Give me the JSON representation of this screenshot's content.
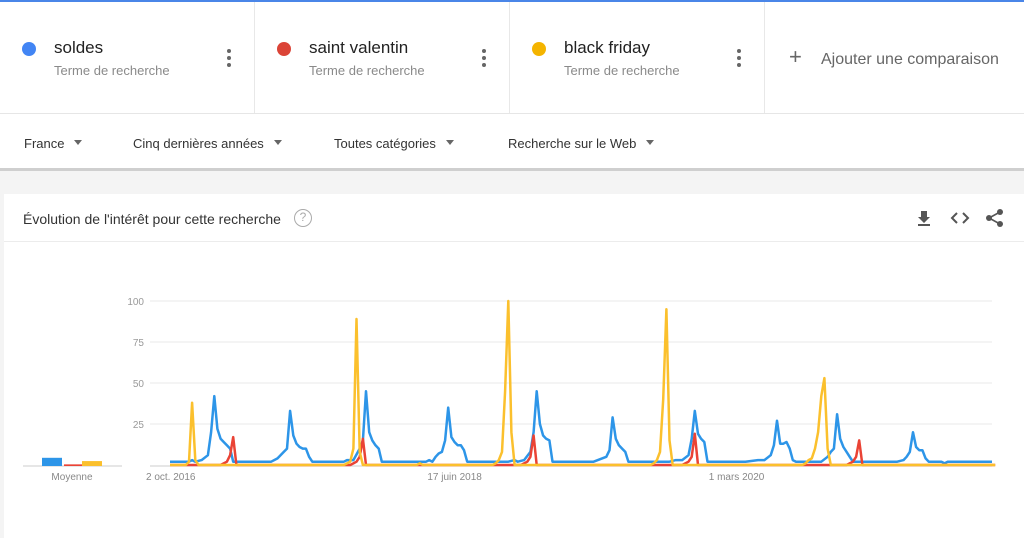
{
  "terms": [
    {
      "name": "soldes",
      "subtitle": "Terme de recherche",
      "color": "#4285f4"
    },
    {
      "name": "saint valentin",
      "subtitle": "Terme de recherche",
      "color": "#db4437"
    },
    {
      "name": "black friday",
      "subtitle": "Terme de recherche",
      "color": "#f4b400"
    }
  ],
  "add_comparison": {
    "icon": "plus-icon",
    "label": "Ajouter une comparaison"
  },
  "filters": [
    {
      "label": "France"
    },
    {
      "label": "Cinq dernières années"
    },
    {
      "label": "Toutes catégories"
    },
    {
      "label": "Recherche sur le Web"
    }
  ],
  "card": {
    "title": "Évolution de l'intérêt pour cette recherche",
    "help_icon": "?",
    "tools": [
      "download-icon",
      "embed-icon",
      "share-icon"
    ]
  },
  "chart_data": {
    "type": "line",
    "title": "Évolution de l'intérêt pour cette recherche",
    "xlabel": "",
    "ylabel": "",
    "ylim": [
      0,
      100
    ],
    "yticks": [
      "25",
      "50",
      "75",
      "100"
    ],
    "ytick_values": [
      25,
      50,
      75,
      100
    ],
    "grid": true,
    "legend": "top",
    "x_weeks": 261,
    "xticks": [
      {
        "label": "2 oct. 2016",
        "week": 0
      },
      {
        "label": "17 juin 2018",
        "week": 89
      },
      {
        "label": "1 mars 2020",
        "week": 178
      }
    ],
    "average": {
      "label": "Moyenne",
      "values": [
        {
          "name": "soldes",
          "value": 5
        },
        {
          "name": "saint valentin",
          "value": 1
        },
        {
          "name": "black friday",
          "value": 3
        }
      ]
    },
    "series": [
      {
        "name": "soldes",
        "color": "#2d95e8",
        "baseline": 2,
        "points": [
          [
            0,
            2
          ],
          [
            6,
            2
          ],
          [
            7,
            3
          ],
          [
            8,
            2
          ],
          [
            10,
            3
          ],
          [
            12,
            6
          ],
          [
            13,
            20
          ],
          [
            14,
            42
          ],
          [
            15,
            22
          ],
          [
            16,
            16
          ],
          [
            17,
            14
          ],
          [
            18,
            12
          ],
          [
            19,
            10
          ],
          [
            20,
            2
          ],
          [
            32,
            2
          ],
          [
            34,
            4
          ],
          [
            36,
            8
          ],
          [
            37,
            10
          ],
          [
            38,
            33
          ],
          [
            39,
            18
          ],
          [
            40,
            13
          ],
          [
            41,
            11
          ],
          [
            42,
            10
          ],
          [
            43,
            10
          ],
          [
            44,
            5
          ],
          [
            45,
            2
          ],
          [
            55,
            2
          ],
          [
            56,
            3
          ],
          [
            58,
            3
          ],
          [
            60,
            10
          ],
          [
            61,
            15
          ],
          [
            62,
            45
          ],
          [
            63,
            20
          ],
          [
            64,
            15
          ],
          [
            65,
            12
          ],
          [
            66,
            10
          ],
          [
            67,
            2
          ],
          [
            81,
            2
          ],
          [
            82,
            3
          ],
          [
            83,
            2
          ],
          [
            84,
            5
          ],
          [
            85,
            7
          ],
          [
            86,
            8
          ],
          [
            87,
            15
          ],
          [
            88,
            35
          ],
          [
            89,
            17
          ],
          [
            90,
            14
          ],
          [
            91,
            12
          ],
          [
            92,
            12
          ],
          [
            93,
            9
          ],
          [
            94,
            2
          ],
          [
            107,
            2
          ],
          [
            109,
            3
          ],
          [
            110,
            2
          ],
          [
            112,
            3
          ],
          [
            114,
            8
          ],
          [
            115,
            20
          ],
          [
            116,
            45
          ],
          [
            117,
            25
          ],
          [
            118,
            18
          ],
          [
            119,
            16
          ],
          [
            120,
            15
          ],
          [
            121,
            2
          ],
          [
            134,
            2
          ],
          [
            138,
            5
          ],
          [
            139,
            9
          ],
          [
            140,
            29
          ],
          [
            141,
            16
          ],
          [
            142,
            12
          ],
          [
            143,
            10
          ],
          [
            144,
            8
          ],
          [
            145,
            2
          ],
          [
            158,
            2
          ],
          [
            160,
            3
          ],
          [
            162,
            3
          ],
          [
            164,
            6
          ],
          [
            165,
            16
          ],
          [
            166,
            33
          ],
          [
            167,
            19
          ],
          [
            168,
            16
          ],
          [
            169,
            14
          ],
          [
            170,
            2
          ],
          [
            182,
            2
          ],
          [
            186,
            3
          ],
          [
            188,
            3
          ],
          [
            190,
            6
          ],
          [
            191,
            12
          ],
          [
            192,
            27
          ],
          [
            193,
            13
          ],
          [
            194,
            13
          ],
          [
            195,
            14
          ],
          [
            196,
            10
          ],
          [
            197,
            3
          ],
          [
            198,
            2
          ],
          [
            206,
            2
          ],
          [
            208,
            5
          ],
          [
            209,
            8
          ],
          [
            210,
            10
          ],
          [
            211,
            31
          ],
          [
            212,
            16
          ],
          [
            213,
            11
          ],
          [
            214,
            8
          ],
          [
            215,
            5
          ],
          [
            216,
            2
          ],
          [
            230,
            2
          ],
          [
            232,
            3
          ],
          [
            233,
            5
          ],
          [
            234,
            8
          ],
          [
            235,
            20
          ],
          [
            236,
            11
          ],
          [
            237,
            9
          ],
          [
            238,
            9
          ],
          [
            239,
            4
          ],
          [
            240,
            2
          ],
          [
            244,
            2
          ],
          [
            245,
            1
          ],
          [
            246,
            2
          ],
          [
            247,
            2
          ]
        ]
      },
      {
        "name": "saint valentin",
        "color": "#ea4335",
        "baseline": 0,
        "points": [
          [
            0,
            0
          ],
          [
            16,
            0
          ],
          [
            17,
            1
          ],
          [
            18,
            2
          ],
          [
            19,
            6
          ],
          [
            20,
            17
          ],
          [
            21,
            0
          ],
          [
            57,
            0
          ],
          [
            58,
            1
          ],
          [
            59,
            2
          ],
          [
            60,
            5
          ],
          [
            61,
            16
          ],
          [
            62,
            0
          ],
          [
            111,
            0
          ],
          [
            112,
            1
          ],
          [
            113,
            2
          ],
          [
            114,
            5
          ],
          [
            115,
            18
          ],
          [
            116,
            0
          ],
          [
            162,
            0
          ],
          [
            163,
            1
          ],
          [
            164,
            2
          ],
          [
            165,
            5
          ],
          [
            166,
            19
          ],
          [
            167,
            0
          ],
          [
            214,
            0
          ],
          [
            215,
            1
          ],
          [
            216,
            2
          ],
          [
            217,
            5
          ],
          [
            218,
            15
          ],
          [
            219,
            0
          ],
          [
            261,
            0
          ]
        ]
      },
      {
        "name": "black friday",
        "color": "#fbc02d",
        "baseline": 0,
        "points": [
          [
            0,
            0
          ],
          [
            5,
            0
          ],
          [
            6,
            2
          ],
          [
            7,
            38
          ],
          [
            8,
            3
          ],
          [
            9,
            0
          ],
          [
            55,
            0
          ],
          [
            56,
            1
          ],
          [
            57,
            2
          ],
          [
            58,
            10
          ],
          [
            59,
            89
          ],
          [
            60,
            8
          ],
          [
            61,
            0
          ],
          [
            78,
            0
          ],
          [
            79,
            1
          ],
          [
            80,
            0
          ],
          [
            102,
            0
          ],
          [
            103,
            1
          ],
          [
            104,
            3
          ],
          [
            105,
            8
          ],
          [
            106,
            45
          ],
          [
            107,
            100
          ],
          [
            108,
            20
          ],
          [
            109,
            0
          ],
          [
            152,
            0
          ],
          [
            153,
            1
          ],
          [
            154,
            3
          ],
          [
            155,
            8
          ],
          [
            156,
            40
          ],
          [
            157,
            95
          ],
          [
            158,
            15
          ],
          [
            159,
            0
          ],
          [
            200,
            0
          ],
          [
            201,
            1
          ],
          [
            202,
            3
          ],
          [
            203,
            4
          ],
          [
            204,
            10
          ],
          [
            205,
            20
          ],
          [
            206,
            42
          ],
          [
            207,
            53
          ],
          [
            208,
            10
          ],
          [
            209,
            0
          ],
          [
            261,
            0
          ]
        ]
      }
    ]
  }
}
